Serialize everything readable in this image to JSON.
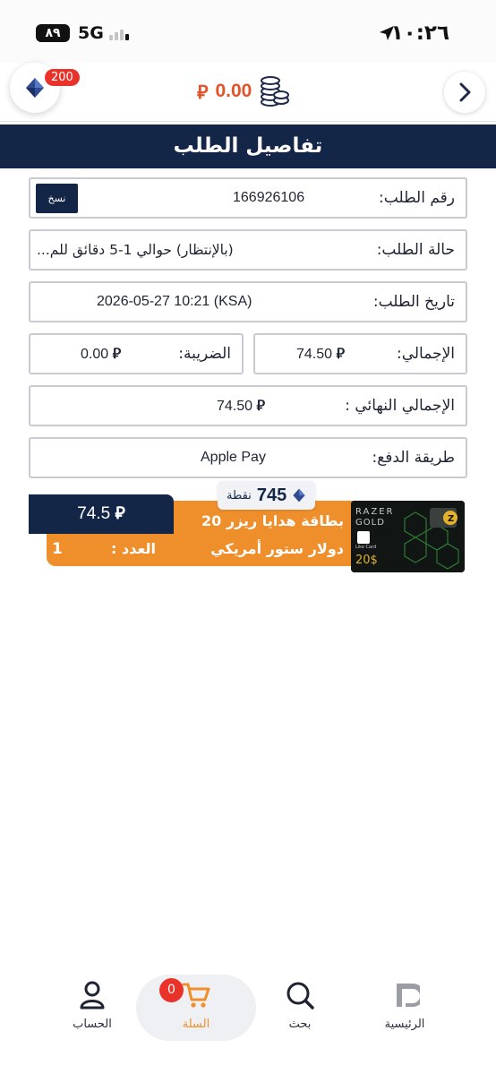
{
  "status_bar": {
    "time": "١٠:٢٦",
    "network": "5G",
    "battery": "٨٩"
  },
  "header": {
    "points_badge": "200",
    "balance": "0.00",
    "currency": "⃁"
  },
  "title": "تفاصيل الطلب",
  "order": {
    "number_label": "رقم الطلب:",
    "number": "166926106",
    "copy_label": "نسخ",
    "status_label": "حالة الطلب:",
    "status": "(بالإنتظار) حوالي 1-5 دقائق للم...",
    "date_label": "تاريخ الطلب:",
    "date": "2026-05-27 10:21 (KSA)",
    "total_label": "الإجمالي:",
    "total": "74.50",
    "tax_label": "الضريبة:",
    "tax": "0.00",
    "final_label": "الإجمالي النهائي :",
    "final": "74.50",
    "payment_label": "طريقة الدفع:",
    "payment": "Apple Pay"
  },
  "product": {
    "points": "745",
    "points_word": "نقطة",
    "price": "74.5",
    "name_line1": "بطاقة هدايا ريزر 20",
    "name_line2": "دولار ستور أمريكي",
    "qty_label": "العدد :",
    "qty": "1",
    "image": {
      "brand_line1": "RAZER",
      "brand_line2": "GOLD",
      "logo_text": "Like Card",
      "amount": "20$"
    }
  },
  "nav": {
    "home": "الرئيسية",
    "search": "بحث",
    "cart": "السلة",
    "cart_count": "0",
    "account": "الحساب"
  },
  "colors": {
    "navy": "#142647",
    "orange": "#ef8f2b",
    "badge_red": "#e8322a",
    "balance_orange": "#e2532a"
  }
}
